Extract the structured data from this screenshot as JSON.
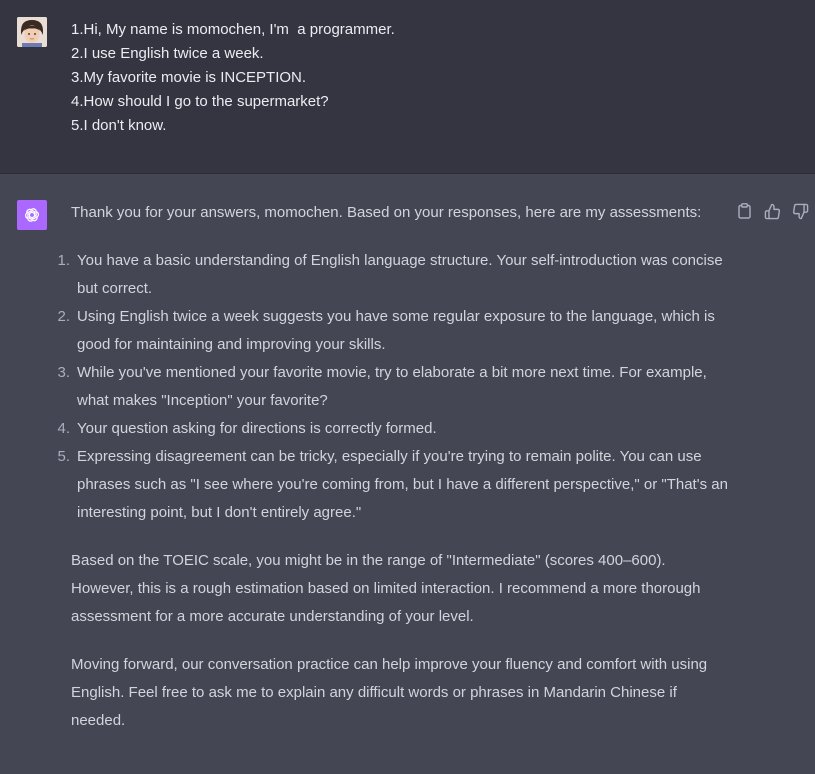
{
  "user_message": {
    "lines": [
      "1.Hi, My name is momochen, I'm  a programmer.",
      "2.I use English twice a week.",
      "3.My favorite movie is INCEPTION.",
      "4.How should I go to the supermarket?",
      "5.I don't know."
    ]
  },
  "assistant_message": {
    "intro": "Thank you for your answers, momochen. Based on your responses, here are my assessments:",
    "items": [
      {
        "num": "1.",
        "text": "You have a basic understanding of English language structure. Your self-introduction was concise but correct."
      },
      {
        "num": "2.",
        "text": "Using English twice a week suggests you have some regular exposure to the language, which is good for maintaining and improving your skills."
      },
      {
        "num": "3.",
        "text": "While you've mentioned your favorite movie, try to elaborate a bit more next time. For example, what makes \"Inception\" your favorite?"
      },
      {
        "num": "4.",
        "text": "Your question asking for directions is correctly formed."
      },
      {
        "num": "5.",
        "text": "Expressing disagreement can be tricky, especially if you're trying to remain polite. You can use phrases such as \"I see where you're coming from, but I have a different perspective,\" or \"That's an interesting point, but I don't entirely agree.\""
      }
    ],
    "paragraph_1": "Based on the TOEIC scale, you might be in the range of \"Intermediate\" (scores 400–600). However, this is a rough estimation based on limited interaction. I recommend a more thorough assessment for a more accurate understanding of your level.",
    "paragraph_2": "Moving forward, our conversation practice can help improve your fluency and comfort with using English. Feel free to ask me to explain any difficult words or phrases in Mandarin Chinese if needed."
  },
  "icons": {
    "copy": "clipboard-icon",
    "thumbs_up": "thumbs-up-icon",
    "thumbs_down": "thumbs-down-icon",
    "assistant_logo": "openai-logo-icon"
  },
  "colors": {
    "user_bg": "#343541",
    "assistant_bg": "#444654",
    "assistant_avatar": "#ab68ff",
    "text": "#d1d5db"
  }
}
